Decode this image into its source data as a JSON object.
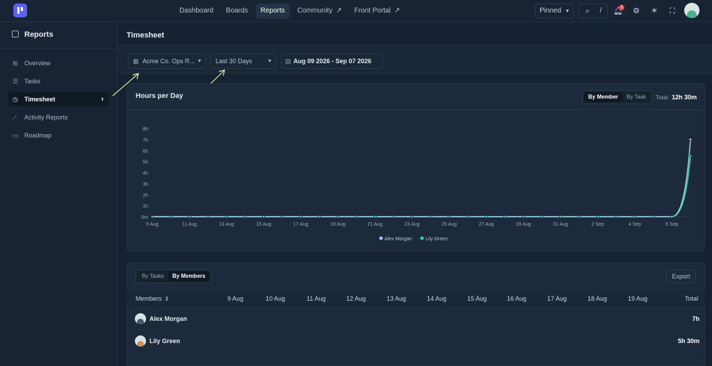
{
  "topnav": {
    "items": [
      {
        "label": "Dashboard",
        "active": false,
        "external": false
      },
      {
        "label": "Boards",
        "active": false,
        "external": false
      },
      {
        "label": "Reports",
        "active": true,
        "external": false
      },
      {
        "label": "Community",
        "active": false,
        "external": true
      },
      {
        "label": "Front Portal",
        "active": false,
        "external": true
      }
    ],
    "pinned_label": "Pinned",
    "shortcut_key": "/",
    "notifications_count": "3"
  },
  "sidebar": {
    "title": "Reports",
    "items": [
      {
        "label": "Overview",
        "icon": "grid-icon",
        "active": false
      },
      {
        "label": "Tasks",
        "icon": "list-icon",
        "active": false
      },
      {
        "label": "Timesheet",
        "icon": "clock-icon",
        "active": true
      },
      {
        "label": "Activity Reports",
        "icon": "trend-icon",
        "active": false
      },
      {
        "label": "Roadmap",
        "icon": "map-icon",
        "active": false
      }
    ]
  },
  "page": {
    "title": "Timesheet",
    "filters": {
      "project": "Acme Co. Ops R...",
      "range": "Last 30 Days",
      "date_range": "Aug 09 2026 - Sep 07 2026"
    }
  },
  "chart_card": {
    "title": "Hours per Day",
    "toggle": [
      {
        "label": "By Member",
        "active": true
      },
      {
        "label": "By Task",
        "active": false
      }
    ],
    "total_label": "Total:",
    "total_value": "12h 30m"
  },
  "chart_data": {
    "type": "line",
    "title": "Hours per Day",
    "x_tick_labels": [
      "9 Aug",
      "11 Aug",
      "13 Aug",
      "15 Aug",
      "17 Aug",
      "19 Aug",
      "21 Aug",
      "23 Aug",
      "25 Aug",
      "27 Aug",
      "29 Aug",
      "31 Aug",
      "2 Sep",
      "4 Sep",
      "6 Sep"
    ],
    "y_tick_labels": [
      "0m",
      "1h",
      "2h",
      "3h",
      "4h",
      "5h",
      "6h",
      "7h",
      "8h"
    ],
    "ylim": [
      0,
      8
    ],
    "x": [
      "9 Aug",
      "10 Aug",
      "11 Aug",
      "12 Aug",
      "13 Aug",
      "14 Aug",
      "15 Aug",
      "16 Aug",
      "17 Aug",
      "18 Aug",
      "19 Aug",
      "20 Aug",
      "21 Aug",
      "22 Aug",
      "23 Aug",
      "24 Aug",
      "25 Aug",
      "26 Aug",
      "27 Aug",
      "28 Aug",
      "29 Aug",
      "30 Aug",
      "31 Aug",
      "1 Sep",
      "2 Sep",
      "3 Sep",
      "4 Sep",
      "5 Sep",
      "6 Sep",
      "7 Sep"
    ],
    "series": [
      {
        "name": "Alex Morgan",
        "color": "#a9c6f7",
        "values": [
          0,
          0,
          0,
          0,
          0,
          0,
          0,
          0,
          0,
          0,
          0,
          0,
          0,
          0,
          0,
          0,
          0,
          0,
          0,
          0,
          0,
          0,
          0,
          0,
          0,
          0,
          0,
          0,
          0,
          7
        ]
      },
      {
        "name": "Lily Green",
        "color": "#2fd6a8",
        "values": [
          0,
          0,
          0,
          0,
          0,
          0,
          0,
          0,
          0,
          0,
          0,
          0,
          0,
          0,
          0,
          0,
          0,
          0,
          0,
          0,
          0,
          0,
          0,
          0,
          0,
          0,
          0,
          0,
          0,
          5.5
        ]
      }
    ],
    "grid": true,
    "legend": "bottom"
  },
  "table_card": {
    "tabs": [
      {
        "label": "By Tasks",
        "active": false
      },
      {
        "label": "By Members",
        "active": true
      }
    ],
    "export_label": "Export",
    "columns": [
      "Members",
      "9 Aug",
      "10 Aug",
      "11 Aug",
      "12 Aug",
      "13 Aug",
      "14 Aug",
      "15 Aug",
      "16 Aug",
      "17 Aug",
      "18 Aug",
      "19 Aug",
      "Total"
    ],
    "rows": [
      {
        "name": "Alex Morgan",
        "total": "7h"
      },
      {
        "name": "Lily Green",
        "total": "5h 30m"
      }
    ]
  }
}
